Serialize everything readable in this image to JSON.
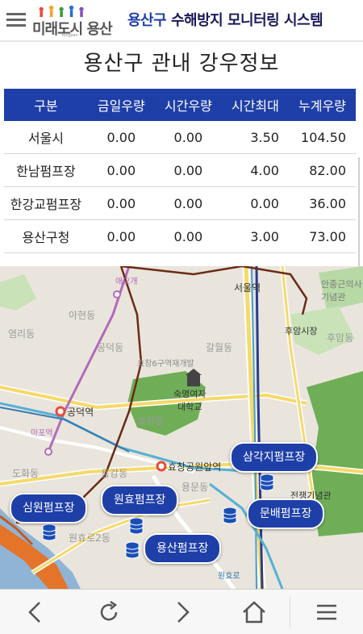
{
  "header": {
    "logo_text": "미래도시 용산",
    "logo_sub": "Yongsan",
    "title_accent": "용산구",
    "title_rest": " 수해방지 모니터링 시스템"
  },
  "page_title": "용산구 관내 강우정보",
  "rain_table": {
    "headers": [
      "구분",
      "금일우량",
      "시간우량",
      "시간최대",
      "누계우량"
    ],
    "rows": [
      [
        "서울시",
        "0.00",
        "0.00",
        "3.50",
        "104.50"
      ],
      [
        "한남펌프장",
        "0.00",
        "0.00",
        "4.00",
        "82.00"
      ],
      [
        "한강교펌프장",
        "0.00",
        "0.00",
        "0.00",
        "36.00"
      ],
      [
        "용산구청",
        "0.00",
        "0.00",
        "3.00",
        "73.00"
      ]
    ]
  },
  "map": {
    "labels": {
      "seoul_station": "서울역",
      "huam_market": "후암시장",
      "huam_dong": "후암동",
      "ahyeon_dong": "아현동",
      "gongdeok_dong": "공덕동",
      "gongdeok_station": "공덕역",
      "sookmyung": "숙명여자\n대학교",
      "hyochang_park_station": "효창공원앞역",
      "hyochang_dong": "효창동",
      "dohwa_dong": "도화동",
      "yonggang_dong": "용강동",
      "memorial": "전쟁기념관",
      "yeomni": "염리동",
      "yongmun": "용문동",
      "galwol": "갈월동",
      "wonhyoro2": "원효로2동",
      "ahjunggeun": "안중근의사\n기념관",
      "euljiro": "애오개",
      "mapo": "마포역",
      "wonhyoro": "원효로",
      "hyochang6": "효창6구역재개발"
    },
    "pumps": [
      "삼각지펌프장",
      "원효펌프장",
      "심원펌프장",
      "문배펌프장",
      "용산펌프장"
    ]
  },
  "navbar": {
    "icons": [
      "back-icon",
      "refresh-icon",
      "forward-icon",
      "home-icon",
      "menu-icon"
    ]
  }
}
